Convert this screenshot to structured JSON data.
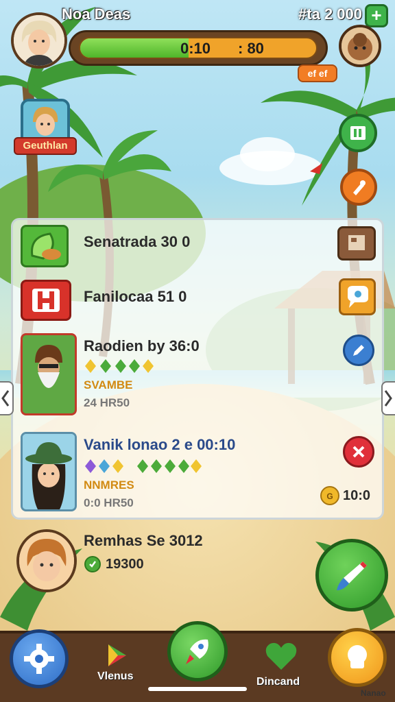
{
  "player": {
    "name": "Noa Deas",
    "progress_text": "0:10",
    "progress_text_right": ": 80",
    "progress_fraction": 0.46
  },
  "currency": {
    "amount": "#ta 2 000"
  },
  "tags": {
    "small_tag": "ef ef",
    "hero_label": "Geuthlan"
  },
  "rows": [
    {
      "title": "Senatrada 30 0"
    },
    {
      "title": "Fanilocaa 51 0"
    },
    {
      "title": "Raodien by 36:0",
      "sub": "SVAMBE",
      "sub2": "24 HR50"
    },
    {
      "title": "Vanik lonao 2 e 00:10",
      "sub": "NNMRES",
      "sub2": "0:0 HR50",
      "reward": "10:0"
    }
  ],
  "bottom_player": {
    "title": "Remhas Se 3012",
    "score": "19300"
  },
  "nav": {
    "item_2_label": "Vlenus",
    "item_4_label": "Dincand"
  },
  "corner_label": "Nanao",
  "colors": {
    "wood": "#5b3a22",
    "green": "#3fb34a",
    "orange": "#f0a32a",
    "red": "#d33a2c",
    "blue": "#3b7fd1"
  }
}
